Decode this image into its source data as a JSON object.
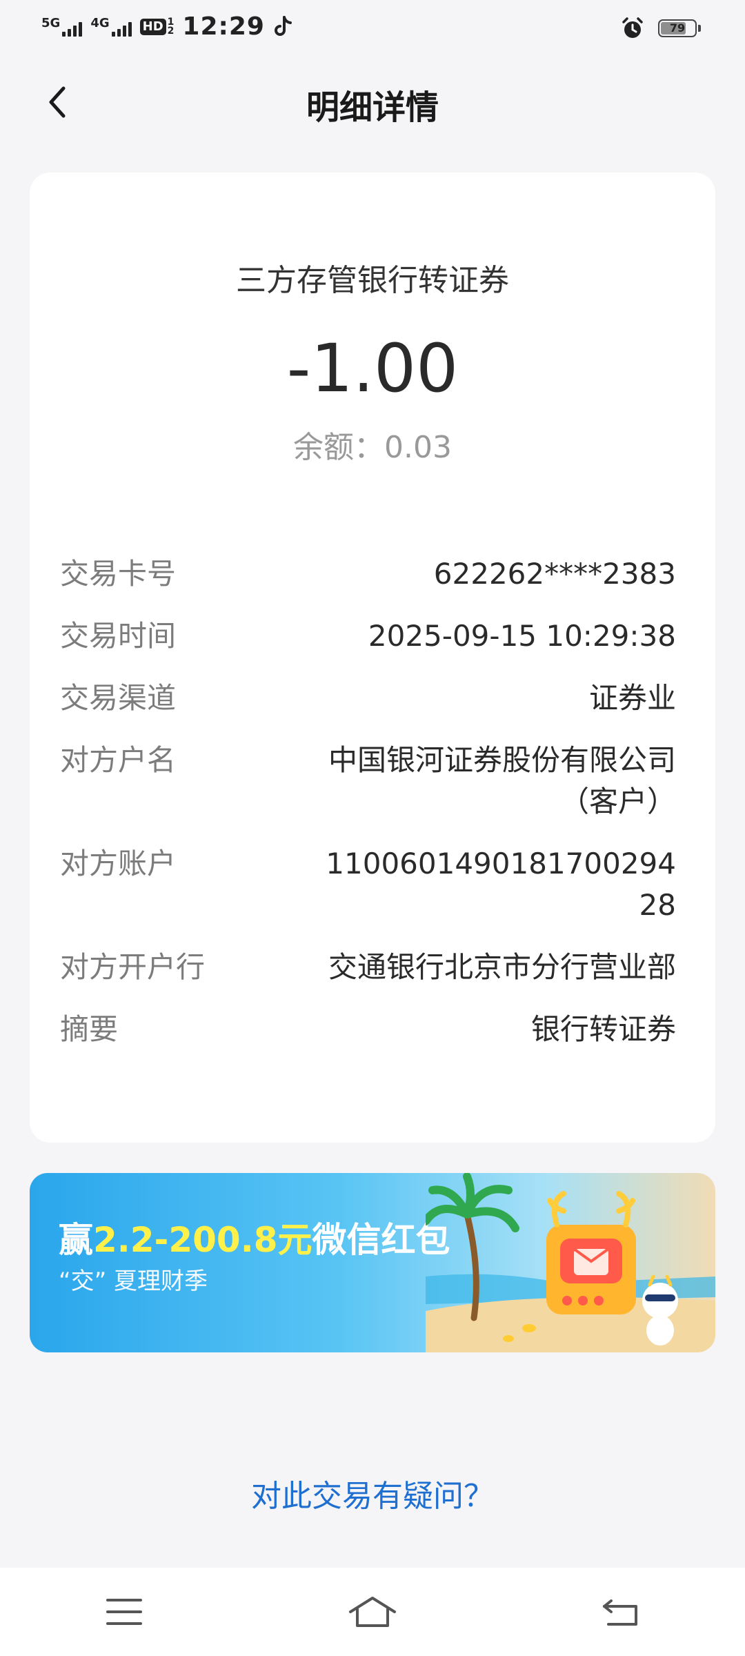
{
  "status_bar": {
    "net1": "5G",
    "net2": "4G",
    "hd_label": "HD",
    "hd_sub_top": "1",
    "hd_sub_bottom": "2",
    "time": "12:29",
    "battery_level": "79"
  },
  "header": {
    "title": "明细详情"
  },
  "transaction": {
    "type": "三方存管银行转证券",
    "amount": "-1.00",
    "balance": "余额：0.03"
  },
  "details": [
    {
      "label": "交易卡号",
      "value": "622262****2383"
    },
    {
      "label": "交易时间",
      "value": "2025-09-15 10:29:38"
    },
    {
      "label": "交易渠道",
      "value": "证券业"
    },
    {
      "label": "对方户名",
      "value": "中国银河证券股份有限公司（客户）"
    },
    {
      "label": "对方账户",
      "value": "110060149018170029428"
    },
    {
      "label": "对方开户行",
      "value": "交通银行北京市分行营业部"
    },
    {
      "label": "摘要",
      "value": "银行转证券"
    }
  ],
  "banner": {
    "title_prefix": "赢",
    "title_highlight": "2.2-200.8元",
    "title_suffix": "微信红包",
    "subtitle": "“交” 夏理财季"
  },
  "question_link": "对此交易有疑问？",
  "icons": {
    "back": "chevron-left-icon",
    "menu": "menu-icon",
    "home": "home-icon",
    "return": "return-icon"
  }
}
